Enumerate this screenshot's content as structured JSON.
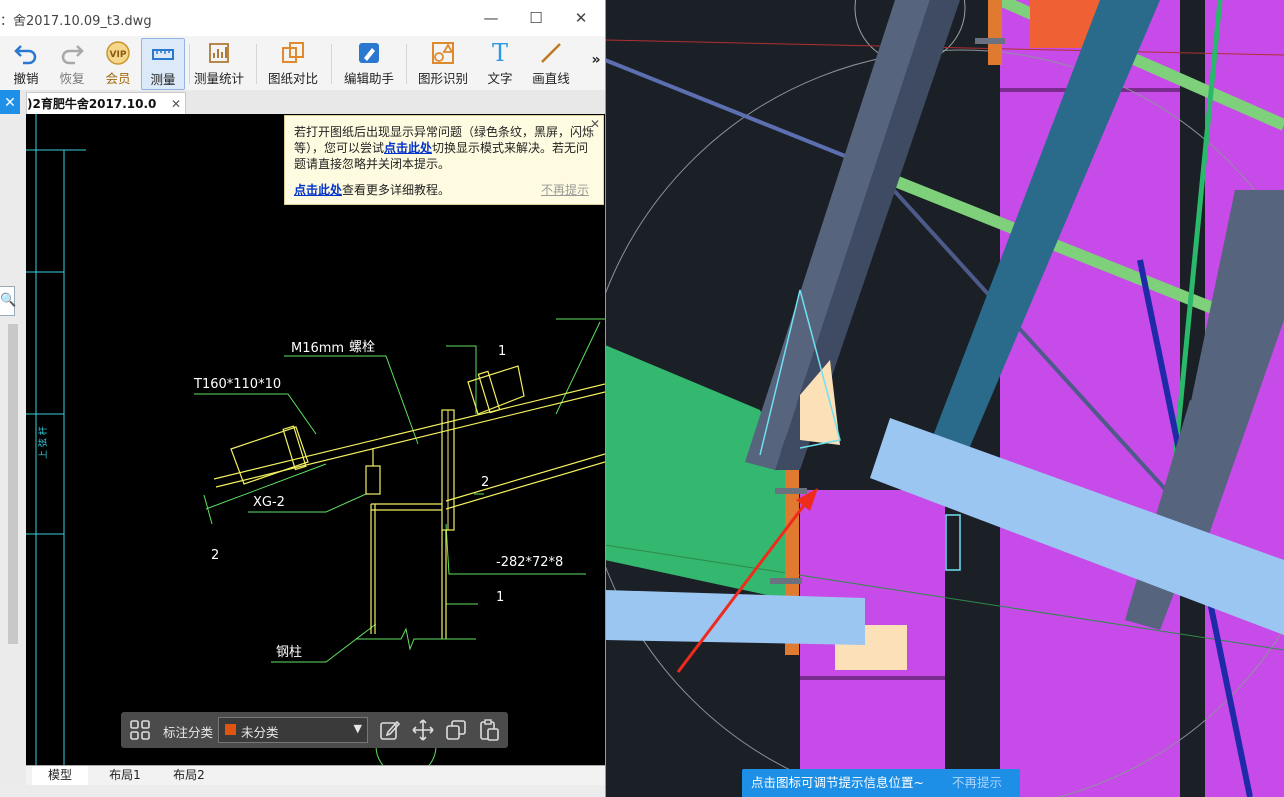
{
  "window": {
    "title": "：舍2017.10.09_t3.dwg",
    "controls": {
      "minimize": "—",
      "maximize": "☐",
      "close": "✕"
    }
  },
  "toolbar": {
    "items": [
      {
        "label": "撤销",
        "icon": "undo-icon"
      },
      {
        "label": "恢复",
        "icon": "redo-icon"
      },
      {
        "label": "会员",
        "icon": "vip-icon",
        "badge": "VIP"
      },
      {
        "label": "测量",
        "icon": "ruler-icon",
        "active": true
      },
      {
        "label": "测量统计",
        "icon": "measure-stats-icon"
      },
      {
        "label": "图纸对比",
        "icon": "compare-icon"
      },
      {
        "label": "编辑助手",
        "icon": "edit-assistant-icon"
      },
      {
        "label": "图形识别",
        "icon": "shape-recognition-icon"
      },
      {
        "label": "文字",
        "icon": "text-icon",
        "glyph": "T"
      },
      {
        "label": "画直线",
        "icon": "line-icon"
      }
    ],
    "more": "»"
  },
  "tabs": {
    "left_tab_glyph": "✕",
    "doc_tab": ")2育肥牛舍2017.10.0",
    "doc_tab_close": "✕"
  },
  "left_panel": {
    "search_glyph": "🔍"
  },
  "notice": {
    "line1_a": "若打开图纸后出现显示异常问题（绿色条纹，黑屏，闪烁等），您可以尝试",
    "link1": "点击此处",
    "line1_b": "切换显示模式来解决。若无问题请直接忽略并关闭本提示。",
    "link2": "点击此处",
    "line2": "查看更多详细教程。",
    "dismiss": "不再提示",
    "close": "✕"
  },
  "drawing_labels": {
    "bolt_size": "M16mm",
    "bolt": "螺栓",
    "plate": "T160*110*10",
    "member": "XG-2",
    "marker1": "1",
    "marker2": "2",
    "marker3": "2",
    "marker4": "1",
    "plate2": "-282*72*8",
    "column": "钢柱"
  },
  "annotation_bar": {
    "label": "标注分类",
    "selected": "未分类",
    "swatch_color": "#e05512",
    "arrow": "▼",
    "icons": [
      "grid-icon",
      "edit-note-icon",
      "move-icon",
      "copy-icon",
      "paste-icon"
    ]
  },
  "bottom_tabs": [
    "模型",
    "布局1",
    "布局2"
  ],
  "tip_bar": {
    "message": "点击图标可调节提示信息位置~",
    "dismiss": "不再提示"
  },
  "colors": {
    "accent_blue": "#1d8fe6",
    "magenta_wall": "#c74be8",
    "teal_beam": "#2a6b8c",
    "green_plane": "#34b870",
    "light_blue_beam": "#9cc6f2",
    "annotation_arrow": "#ee2b1c"
  }
}
